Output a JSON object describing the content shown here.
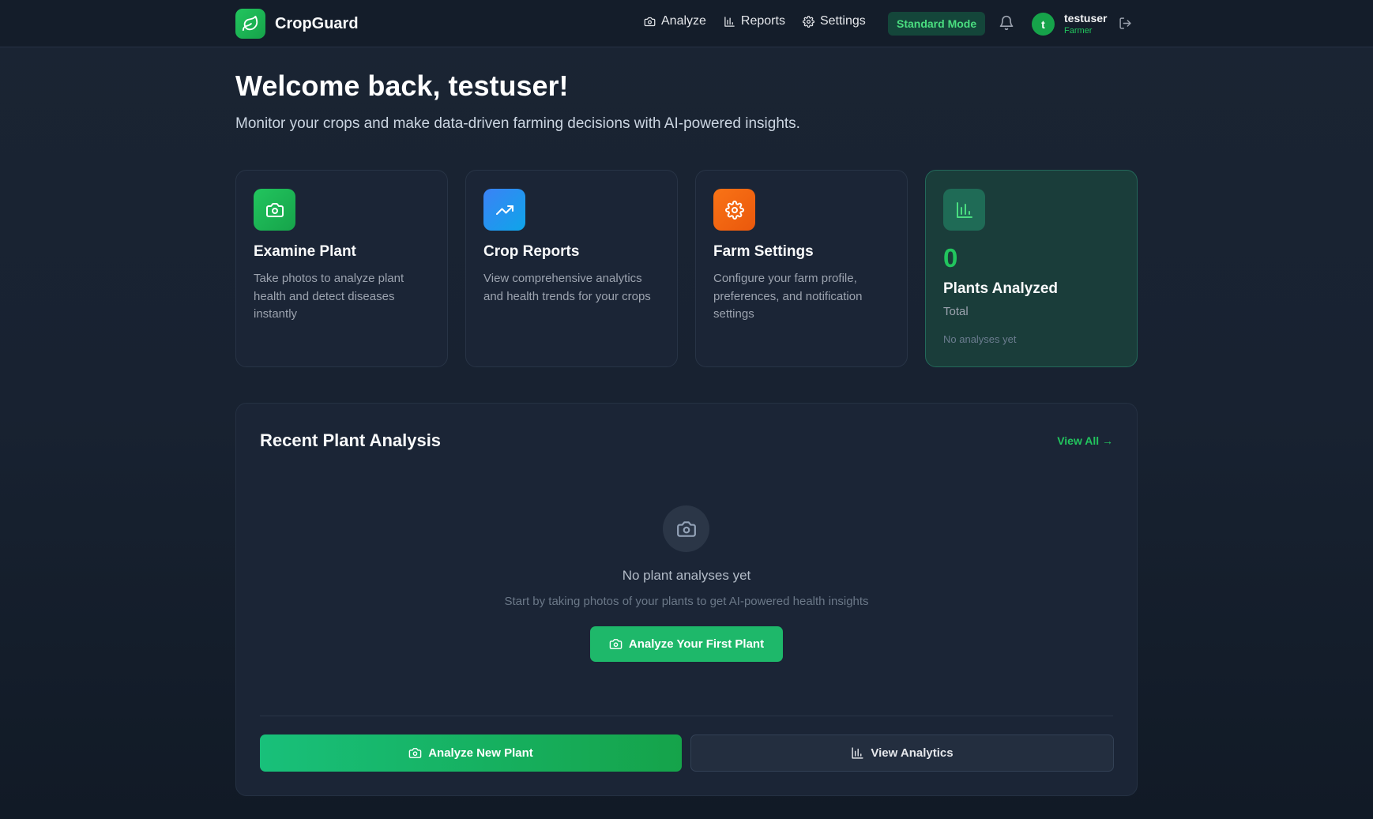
{
  "brand": {
    "name": "CropGuard",
    "logo_icon": "leaf-icon",
    "accent": "#22c55e"
  },
  "nav": [
    {
      "label": "Analyze",
      "icon": "camera-icon"
    },
    {
      "label": "Reports",
      "icon": "bar-chart-icon"
    },
    {
      "label": "Settings",
      "icon": "gear-icon"
    }
  ],
  "mode_badge": "Standard Mode",
  "user": {
    "initial": "t",
    "name": "testuser",
    "role": "Farmer"
  },
  "welcome": {
    "title": "Welcome back, testuser!",
    "subtitle": "Monitor your crops and make data-driven farming decisions with AI-powered insights."
  },
  "cards": [
    {
      "title": "Examine Plant",
      "desc": "Take photos to analyze plant health and detect diseases instantly",
      "icon": "camera-icon",
      "color": "#22c55e"
    },
    {
      "title": "Crop Reports",
      "desc": "View comprehensive analytics and health trends for your crops",
      "icon": "trending-up-icon",
      "color": "#3b82f6"
    },
    {
      "title": "Farm Settings",
      "desc": "Configure your farm profile, preferences, and notification settings",
      "icon": "gear-icon",
      "color": "#f97316"
    }
  ],
  "stat": {
    "value": "0",
    "label": "Plants Analyzed",
    "sub": "Total",
    "note": "No analyses yet",
    "icon": "bar-chart-icon"
  },
  "recent": {
    "title": "Recent Plant Analysis",
    "view_all": "View All →",
    "empty_title": "No plant analyses yet",
    "empty_desc": "Start by taking photos of your plants to get AI-powered health insights",
    "first_button": "Analyze Your First Plant"
  },
  "actions": {
    "analyze_new": "Analyze New Plant",
    "view_analytics": "View Analytics"
  }
}
